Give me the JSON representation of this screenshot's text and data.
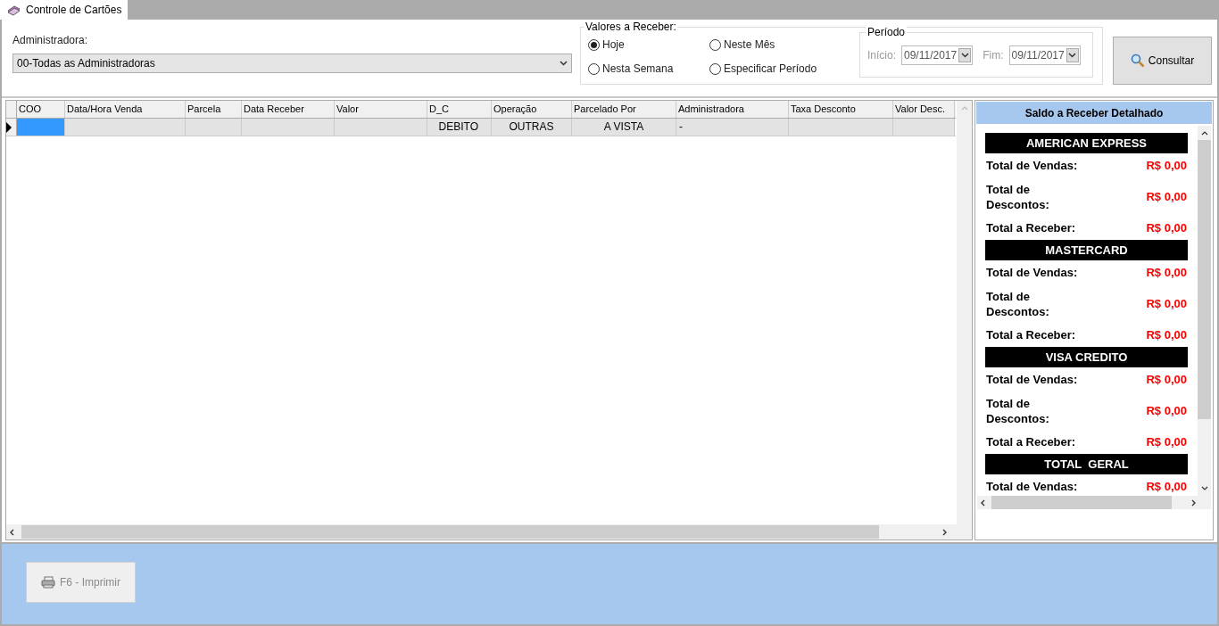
{
  "tab": {
    "label": "Controle de Cartões",
    "selected": true
  },
  "administradora": {
    "label": "Administradora:",
    "value": "00-Todas as Administradoras"
  },
  "valores": {
    "title": "Valores a Receber:",
    "options": [
      {
        "label": "Hoje",
        "selected": true
      },
      {
        "label": "Neste Mês",
        "selected": false
      },
      {
        "label": "Nesta Semana",
        "selected": false
      },
      {
        "label": "Especificar Período",
        "selected": false
      }
    ]
  },
  "periodo": {
    "title": "Período",
    "disabled": true,
    "inicio_label": "Início:",
    "inicio": "09/11/2017",
    "fim_label": "Fim:",
    "fim": "09/11/2017"
  },
  "consultar": "Consultar",
  "table": {
    "columns": [
      "COO",
      "Data/Hora Venda",
      "Parcela",
      "Data Receber",
      "Valor",
      "D_C",
      "Operação",
      "Parcelado Por",
      "Administradora",
      "Taxa Desconto",
      "Valor Desc."
    ],
    "rows": [
      {
        "selected": true,
        "cells": [
          {
            "selected": true
          },
          {
            "selected": false
          },
          {
            "selected": false
          },
          {
            "selected": false
          },
          {
            "selected": false
          },
          {
            "text": "DEBITO",
            "selected": false
          },
          {
            "text": "OUTRAS",
            "selected": false
          },
          {
            "text": "A VISTA",
            "selected": false
          },
          {
            "text": "-",
            "selected": false
          },
          {
            "selected": false
          },
          {
            "selected": false
          }
        ]
      }
    ]
  },
  "saldo": {
    "title": "Saldo a Receber Detalhado",
    "groups": [
      {
        "name": "AMERICAN EXPRESS",
        "lines": [
          {
            "label": "Total de Vendas:",
            "value": "R$ 0,00"
          },
          {
            "label": "Total de Descontos:",
            "value": "R$ 0,00"
          },
          {
            "label": "Total a Receber:",
            "value": "R$ 0,00"
          }
        ]
      },
      {
        "name": "MASTERCARD",
        "lines": [
          {
            "label": "Total de Vendas:",
            "value": "R$ 0,00"
          },
          {
            "label": "Total de Descontos:",
            "value": "R$ 0,00"
          },
          {
            "label": "Total a Receber:",
            "value": "R$ 0,00"
          }
        ]
      },
      {
        "name": "VISA CREDITO",
        "lines": [
          {
            "label": "Total de Vendas:",
            "value": "R$ 0,00"
          },
          {
            "label": "Total de Descontos:",
            "value": "R$ 0,00"
          },
          {
            "label": "Total a Receber:",
            "value": "R$ 0,00"
          }
        ]
      },
      {
        "name": "TOTAL  GERAL",
        "lines": [
          {
            "label": "Total de Vendas:",
            "value": "R$ 0,00"
          }
        ]
      }
    ]
  },
  "print_button": {
    "label": "F6 - Imprimir",
    "disabled": true
  }
}
